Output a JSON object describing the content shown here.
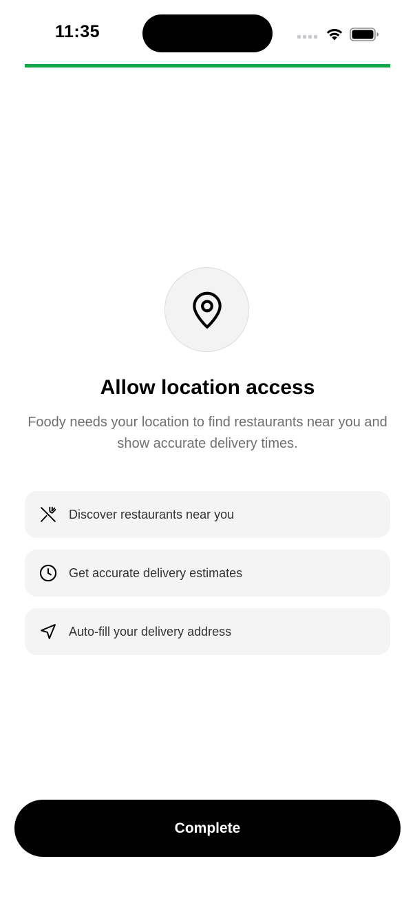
{
  "status_bar": {
    "time": "11:35"
  },
  "progress": {
    "fraction": 1.0,
    "color": "#12a84a"
  },
  "hero": {
    "icon": "map-pin-icon",
    "title": "Allow location access",
    "subtitle": "Foody needs your location to find restaurants near you and show accurate delivery times."
  },
  "benefits": [
    {
      "icon": "fork-knife-icon",
      "label": "Discover restaurants near you"
    },
    {
      "icon": "clock-icon",
      "label": "Get accurate delivery estimates"
    },
    {
      "icon": "navigation-arrow-icon",
      "label": "Auto-fill your delivery address"
    }
  ],
  "actions": {
    "complete_label": "Complete"
  }
}
